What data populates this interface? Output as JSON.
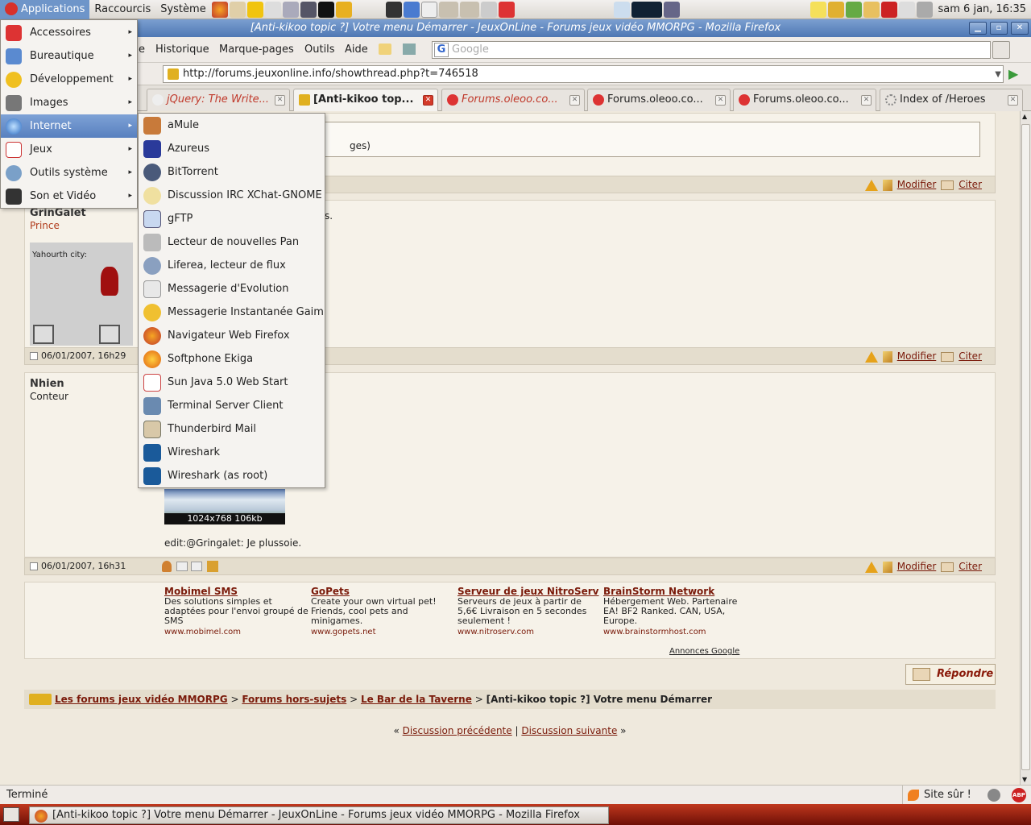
{
  "panel": {
    "applications": "Applications",
    "places": "Raccourcis",
    "system": "Système",
    "clock": "sam  6 jan, 16:35"
  },
  "window": {
    "title": "[Anti-kikoo topic ?] Votre menu Démarrer - JeuxOnLine - Forums jeux vidéo MMORPG - Mozilla Firefox",
    "min": "▁",
    "max": "▫",
    "close": "✕"
  },
  "menubar": {
    "history": "Historique",
    "bookmarks": "Marque-pages",
    "tools": "Outils",
    "help": "Aide",
    "edit_tail": "e"
  },
  "search": {
    "placeholder": "Google",
    "engine": "G"
  },
  "url": {
    "value": "http://forums.jeuxonline.info/showthread.php?t=746518"
  },
  "tabs": [
    {
      "label": "jQuery: The Write..."
    },
    {
      "label": "[Anti-kikoo top..."
    },
    {
      "label": "Forums.oleoo.co..."
    },
    {
      "label": "Forums.oleoo.co..."
    },
    {
      "label": "Forums.oleoo.co..."
    },
    {
      "label": "Index of /Heroes"
    }
  ],
  "appmenu": [
    {
      "label": "Accessoires"
    },
    {
      "label": "Bureautique"
    },
    {
      "label": "Développement"
    },
    {
      "label": "Images"
    },
    {
      "label": "Internet"
    },
    {
      "label": "Jeux"
    },
    {
      "label": "Outils système"
    },
    {
      "label": "Son et Vidéo"
    }
  ],
  "arrow": "▸",
  "submenu": [
    {
      "label": "aMule"
    },
    {
      "label": "Azureus"
    },
    {
      "label": "BitTorrent"
    },
    {
      "label": "Discussion IRC XChat-GNOME"
    },
    {
      "label": "gFTP"
    },
    {
      "label": "Lecteur de nouvelles Pan"
    },
    {
      "label": "Liferea, lecteur de flux"
    },
    {
      "label": "Messagerie d'Evolution"
    },
    {
      "label": "Messagerie Instantanée Gaim"
    },
    {
      "label": "Navigateur Web Firefox"
    },
    {
      "label": "Softphone Ekiga"
    },
    {
      "label": "Sun Java 5.0 Web Start"
    },
    {
      "label": "Terminal Server Client"
    },
    {
      "label": "Thunderbird Mail"
    },
    {
      "label": "Wireshark"
    },
    {
      "label": "Wireshark (as root)"
    }
  ],
  "forum": {
    "quote_tail": "ges)",
    "post1_text_tail": "s.",
    "user1": {
      "name": "GrinGalet",
      "rank": "Prince",
      "avatar_text": "Yahourth city:"
    },
    "user2": {
      "name": "Nhien",
      "rank": "Conteur"
    },
    "date1": "06/01/2007, 16h29",
    "date2": "06/01/2007, 16h31",
    "modify": "Modifier",
    "quote": "Citer",
    "thumb_caption": "1024x768 106kb",
    "edit_text": "edit:@Gringalet: Je plussoie.",
    "ads": [
      {
        "title": "Mobimel SMS",
        "text": "Des solutions simples et adaptées pour l'envoi groupé de SMS",
        "url": "www.mobimel.com"
      },
      {
        "title": "GoPets",
        "text": "Create your own virtual pet! Friends, cool pets and minigames.",
        "url": "www.gopets.net"
      },
      {
        "title": "Serveur de jeux NitroServ",
        "text": "Serveurs de jeux à partir de 5,6€ Livraison en 5 secondes seulement !",
        "url": "www.nitroserv.com"
      },
      {
        "title": "BrainStorm Network",
        "text": "Hébergement Web. Partenaire EA! BF2 Ranked. CAN, USA, Europe.",
        "url": "www.brainstormhost.com"
      }
    ],
    "ads_label": "Annonces Google",
    "reply": "Répondre",
    "breadcrumb": {
      "home": "Les forums jeux vidéo MMORPG",
      "sep": ">",
      "c1": "Forums hors-sujets",
      "c2": "Le Bar de la Taverne",
      "current": "[Anti-kikoo topic ?] Votre menu Démarrer"
    },
    "nav": {
      "prev": "Discussion précédente",
      "next": "Discussion suivante",
      "lq": "«",
      "rq": "»",
      "pipe": "|"
    }
  },
  "status": {
    "text": "Terminé",
    "secure": "Site sûr !",
    "abp": "ABP"
  },
  "taskbar": {
    "item": "[Anti-kikoo topic ?] Votre menu Démarrer - JeuxOnLine - Forums jeux vidéo MMORPG - Mozilla Firefox"
  }
}
